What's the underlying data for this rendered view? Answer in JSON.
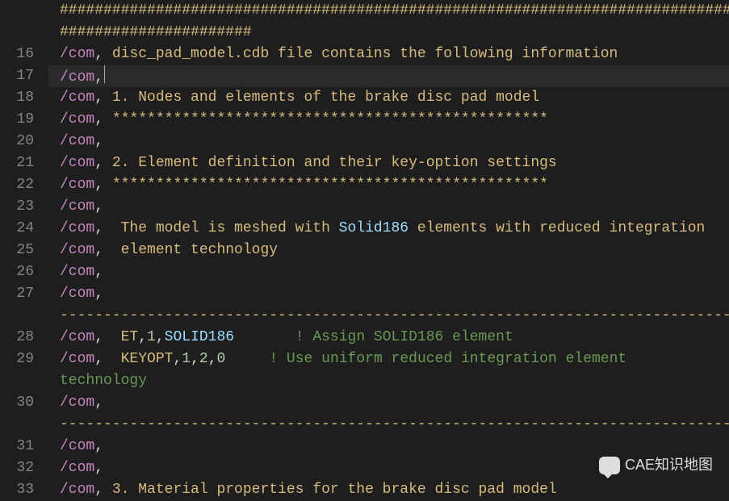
{
  "gutter": [
    "",
    "16",
    "17",
    "18",
    "19",
    "20",
    "21",
    "22",
    "23",
    "24",
    "25",
    "26",
    "27",
    "",
    "28",
    "29",
    "",
    "30",
    "",
    "31",
    "32",
    "33"
  ],
  "watermark": {
    "label": "CAE知识地图"
  },
  "lines": [
    {
      "num": "",
      "seq": [
        {
          "t": "##################################################################################################",
          "c": "tk-text"
        }
      ]
    },
    {
      "num": "",
      "seq": [
        {
          "t": "######################",
          "c": "tk-text"
        }
      ]
    },
    {
      "num": "16",
      "seq": [
        {
          "t": "/com",
          "c": "tk-cmd"
        },
        {
          "t": ", ",
          "c": "tk-punc"
        },
        {
          "t": "disc_pad_model.cdb file contains the following information",
          "c": "tk-text"
        }
      ]
    },
    {
      "num": "17",
      "active": true,
      "seq": [
        {
          "t": "/com",
          "c": "tk-cmd"
        },
        {
          "t": ",",
          "c": "tk-punc"
        },
        {
          "cursor": true
        }
      ]
    },
    {
      "num": "18",
      "seq": [
        {
          "t": "/com",
          "c": "tk-cmd"
        },
        {
          "t": ", ",
          "c": "tk-punc"
        },
        {
          "t": "1. Nodes and elements of the brake disc pad model",
          "c": "tk-text"
        }
      ]
    },
    {
      "num": "19",
      "seq": [
        {
          "t": "/com",
          "c": "tk-cmd"
        },
        {
          "t": ", ",
          "c": "tk-punc"
        },
        {
          "t": "**************************************************",
          "c": "tk-text"
        }
      ]
    },
    {
      "num": "20",
      "seq": [
        {
          "t": "/com",
          "c": "tk-cmd"
        },
        {
          "t": ",",
          "c": "tk-punc"
        }
      ]
    },
    {
      "num": "21",
      "seq": [
        {
          "t": "/com",
          "c": "tk-cmd"
        },
        {
          "t": ", ",
          "c": "tk-punc"
        },
        {
          "t": "2. Element definition and their key-option settings",
          "c": "tk-text"
        }
      ]
    },
    {
      "num": "22",
      "seq": [
        {
          "t": "/com",
          "c": "tk-cmd"
        },
        {
          "t": ", ",
          "c": "tk-punc"
        },
        {
          "t": "**************************************************",
          "c": "tk-text"
        }
      ]
    },
    {
      "num": "23",
      "seq": [
        {
          "t": "/com",
          "c": "tk-cmd"
        },
        {
          "t": ",",
          "c": "tk-punc"
        }
      ]
    },
    {
      "num": "24",
      "seq": [
        {
          "t": "/com",
          "c": "tk-cmd"
        },
        {
          "t": ",  ",
          "c": "tk-punc"
        },
        {
          "t": "The model is meshed with ",
          "c": "tk-text"
        },
        {
          "t": "Solid186",
          "c": "tk-ident"
        },
        {
          "t": " elements with reduced integration",
          "c": "tk-text"
        }
      ]
    },
    {
      "num": "25",
      "seq": [
        {
          "t": "/com",
          "c": "tk-cmd"
        },
        {
          "t": ",  ",
          "c": "tk-punc"
        },
        {
          "t": "element technology",
          "c": "tk-text"
        }
      ]
    },
    {
      "num": "26",
      "seq": [
        {
          "t": "/com",
          "c": "tk-cmd"
        },
        {
          "t": ",",
          "c": "tk-punc"
        }
      ]
    },
    {
      "num": "27",
      "seq": [
        {
          "t": "/com",
          "c": "tk-cmd"
        },
        {
          "t": ", ",
          "c": "tk-punc"
        }
      ]
    },
    {
      "num": "",
      "seq": [
        {
          "t": "----------------------------------------------------------------------------------",
          "c": "tk-dashes"
        }
      ]
    },
    {
      "num": "28",
      "seq": [
        {
          "t": "/com",
          "c": "tk-cmd"
        },
        {
          "t": ",  ",
          "c": "tk-punc"
        },
        {
          "t": "ET",
          "c": "tk-text"
        },
        {
          "t": ",",
          "c": "tk-punc"
        },
        {
          "t": "1",
          "c": "tk-num"
        },
        {
          "t": ",",
          "c": "tk-punc"
        },
        {
          "t": "SOLID186",
          "c": "tk-ident"
        },
        {
          "t": "       ",
          "c": "tk-punc"
        },
        {
          "t": "! Assign SOLID186 element",
          "c": "tk-comment"
        }
      ]
    },
    {
      "num": "29",
      "seq": [
        {
          "t": "/com",
          "c": "tk-cmd"
        },
        {
          "t": ",  ",
          "c": "tk-punc"
        },
        {
          "t": "KEYOPT",
          "c": "tk-text"
        },
        {
          "t": ",",
          "c": "tk-punc"
        },
        {
          "t": "1",
          "c": "tk-num"
        },
        {
          "t": ",",
          "c": "tk-punc"
        },
        {
          "t": "2",
          "c": "tk-num"
        },
        {
          "t": ",",
          "c": "tk-punc"
        },
        {
          "t": "0",
          "c": "tk-num"
        },
        {
          "t": "     ",
          "c": "tk-punc"
        },
        {
          "t": "! Use uniform reduced integration element ",
          "c": "tk-comment"
        }
      ]
    },
    {
      "num": "",
      "seq": [
        {
          "t": "technology",
          "c": "tk-comment"
        }
      ]
    },
    {
      "num": "30",
      "seq": [
        {
          "t": "/com",
          "c": "tk-cmd"
        },
        {
          "t": ", ",
          "c": "tk-punc"
        }
      ]
    },
    {
      "num": "",
      "seq": [
        {
          "t": "----------------------------------------------------------------------------------",
          "c": "tk-dashes"
        }
      ]
    },
    {
      "num": "31",
      "seq": [
        {
          "t": "/com",
          "c": "tk-cmd"
        },
        {
          "t": ",",
          "c": "tk-punc"
        }
      ]
    },
    {
      "num": "32",
      "seq": [
        {
          "t": "/com",
          "c": "tk-cmd"
        },
        {
          "t": ",",
          "c": "tk-punc"
        }
      ]
    },
    {
      "num": "33",
      "seq": [
        {
          "t": "/com",
          "c": "tk-cmd"
        },
        {
          "t": ", ",
          "c": "tk-punc"
        },
        {
          "t": "3. Material properties for the brake disc pad model",
          "c": "tk-text"
        }
      ]
    }
  ]
}
